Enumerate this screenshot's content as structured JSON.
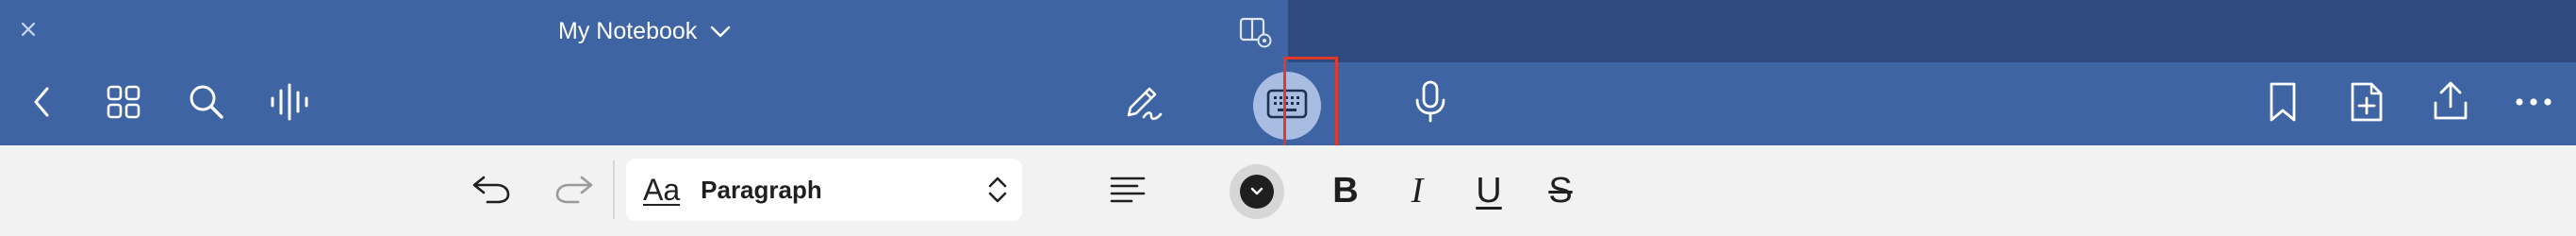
{
  "window": {
    "title": "My Notebook"
  },
  "icons": {
    "close": "close-icon",
    "title_dropdown": "chevron-down-icon",
    "split_view": "split-view-icon",
    "back": "chevron-left-icon",
    "grid": "grid-icon",
    "search": "search-icon",
    "audio": "waveform-icon",
    "pen": "pen-icon",
    "keyboard": "keyboard-icon",
    "microphone": "microphone-icon",
    "bookmark": "bookmark-icon",
    "add_page": "add-page-icon",
    "share": "share-icon",
    "more": "more-icon"
  },
  "ribbon": {
    "style_prefix": "Aa",
    "paragraph_style": "Paragraph",
    "bold": "B",
    "italic": "I",
    "underline": "U",
    "strikethrough": "S"
  },
  "colors": {
    "toolbar_bg": "#3e64a4",
    "titlebar_inactive": "#2e4a7e",
    "ribbon_bg": "#f2f2f2",
    "active_circle": "#a9bde3",
    "highlight": "#e03a2a"
  }
}
